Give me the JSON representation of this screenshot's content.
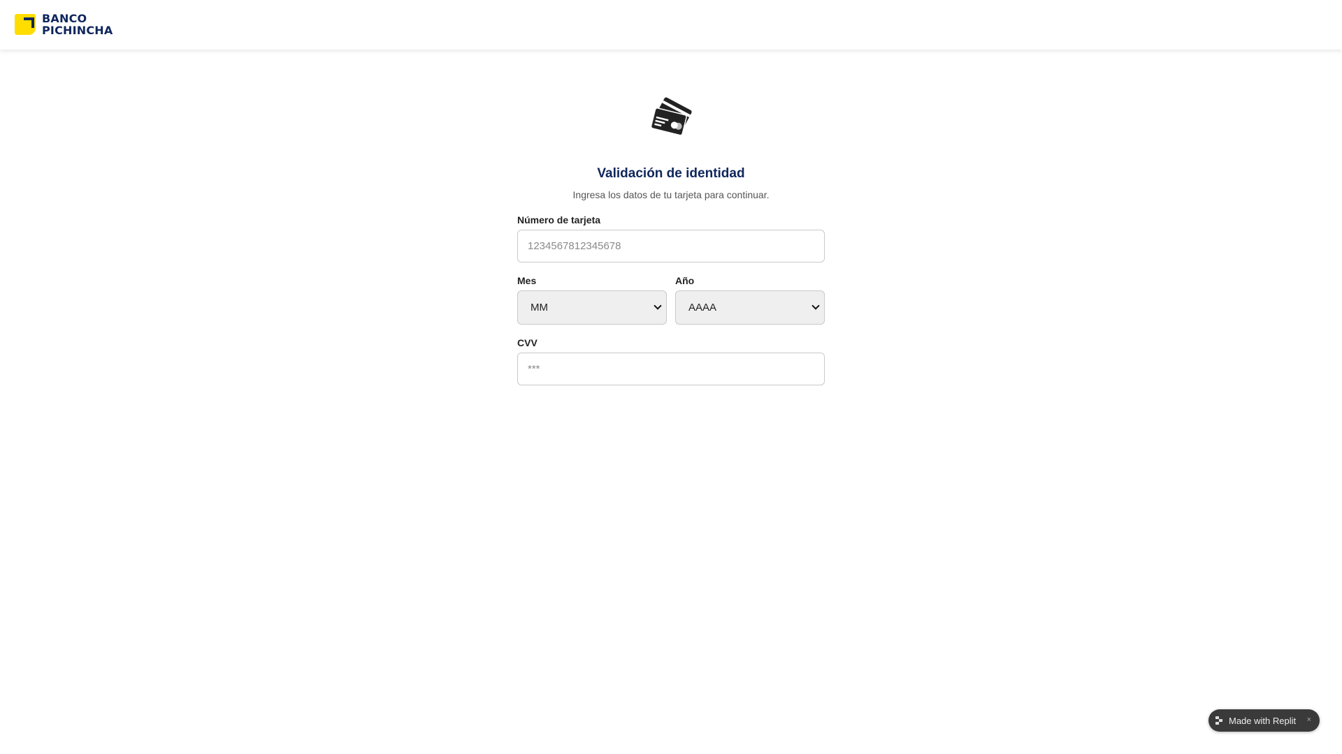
{
  "brand": {
    "line1": "BANCO",
    "line2": "PICHINCHA",
    "accent": "#ffdd00",
    "primary": "#0f265c"
  },
  "page": {
    "icon": "credit-cards-icon",
    "title": "Validación de identidad",
    "subtitle": "Ingresa los datos de tu tarjeta para continuar."
  },
  "form": {
    "card_number": {
      "label": "Número de tarjeta",
      "placeholder": "1234567812345678"
    },
    "month": {
      "label": "Mes",
      "value": "MM"
    },
    "year": {
      "label": "Año",
      "value": "AAAA"
    },
    "cvv": {
      "label": "CVV",
      "placeholder": "***"
    }
  },
  "badge": {
    "label": "Made with Replit",
    "close": "×",
    "icon": "replit-icon"
  }
}
